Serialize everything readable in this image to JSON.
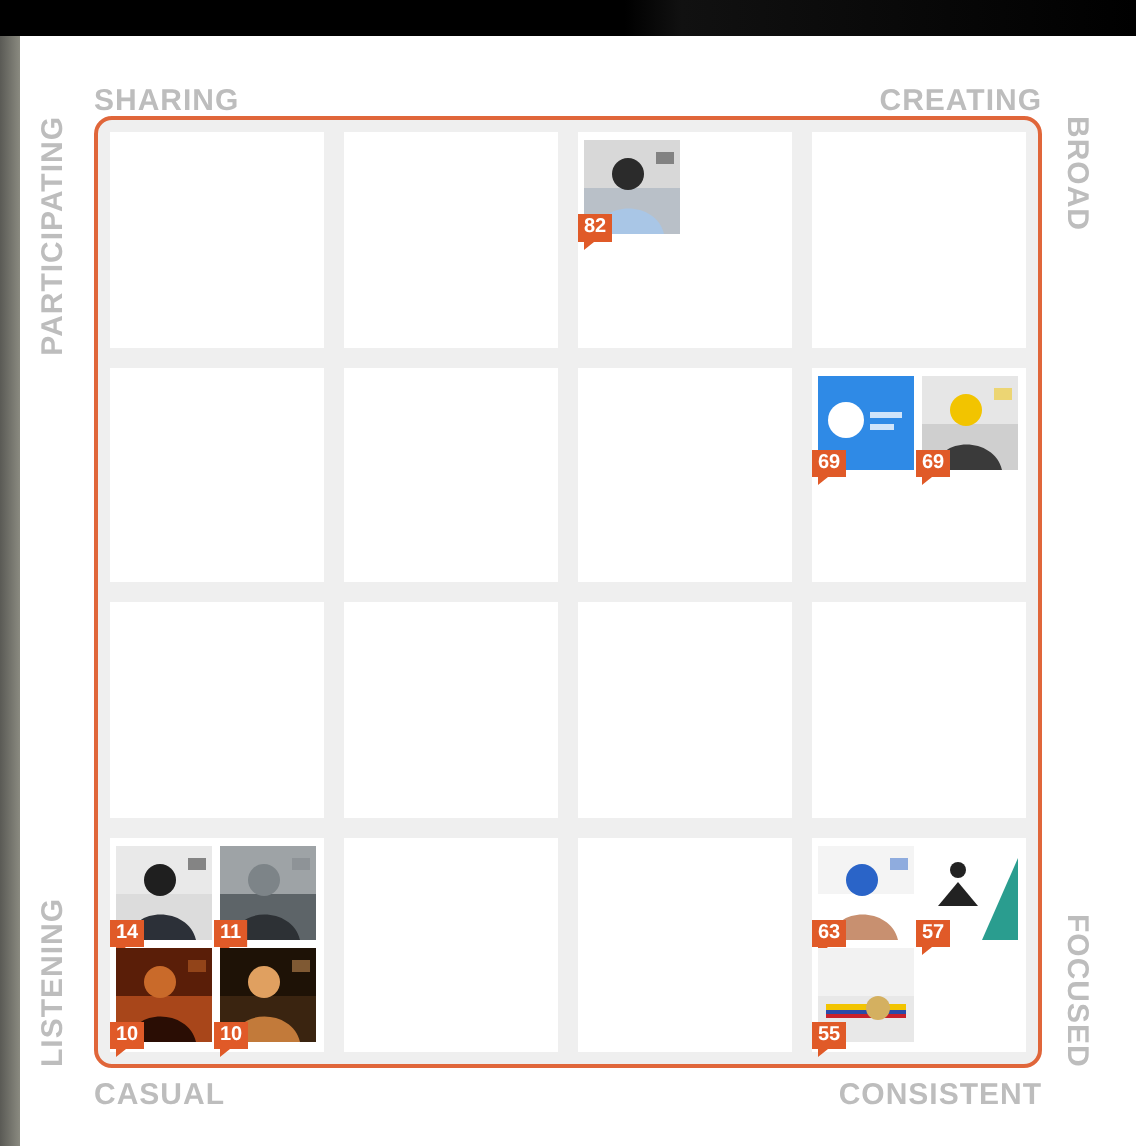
{
  "top_labels": [
    "SHARING",
    "CREATING"
  ],
  "left_labels": [
    "PARTICIPATING",
    "LISTENING"
  ],
  "right_labels": [
    "BROAD",
    "FOCUSED"
  ],
  "bottom_labels": [
    "CASUAL",
    "CONSISTENT"
  ],
  "grid": {
    "rows": [
      {
        "cells": [
          {},
          {},
          {
            "items": [
              {
                "score": "82"
              }
            ]
          },
          {}
        ]
      },
      {
        "cells": [
          {},
          {},
          {},
          {
            "items": [
              {
                "score": "69"
              },
              {
                "score": "69"
              }
            ]
          }
        ]
      },
      {
        "cells": [
          {},
          {},
          {},
          {}
        ]
      },
      {
        "cells": [
          {
            "items": [
              {
                "score": "14"
              },
              {
                "score": "11"
              },
              {
                "score": "10"
              },
              {
                "score": "10"
              }
            ]
          },
          {},
          {},
          {
            "items": [
              {
                "score": "63"
              },
              {
                "score": "57"
              },
              {
                "score": "55"
              }
            ]
          }
        ]
      }
    ]
  }
}
